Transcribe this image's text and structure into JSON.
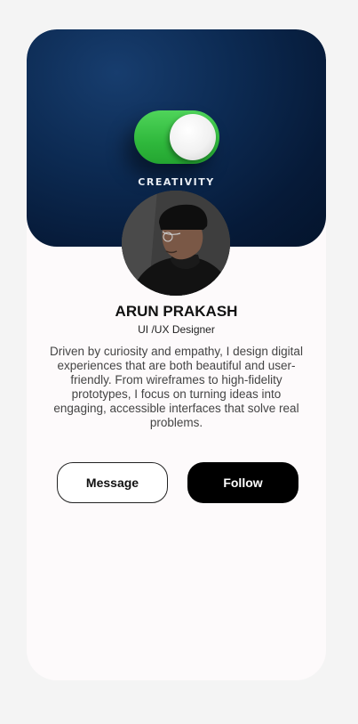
{
  "banner": {
    "label": "CREATIVITY",
    "toggle_state": "on",
    "toggle_color": "#34c23f"
  },
  "profile": {
    "avatar_icon": "profile-photo",
    "name": "ARUN PRAKASH",
    "role": "UI /UX Designer",
    "bio": "Driven by curiosity and empathy, I design digital experiences that are both beautiful and user-friendly. From wireframes to high-fidelity prototypes, I focus on turning ideas into engaging, accessible interfaces that solve real problems."
  },
  "actions": {
    "message_label": "Message",
    "follow_label": "Follow"
  },
  "colors": {
    "banner": "#0c2a52",
    "card": "#fdfafb",
    "follow_button": "#000000"
  }
}
